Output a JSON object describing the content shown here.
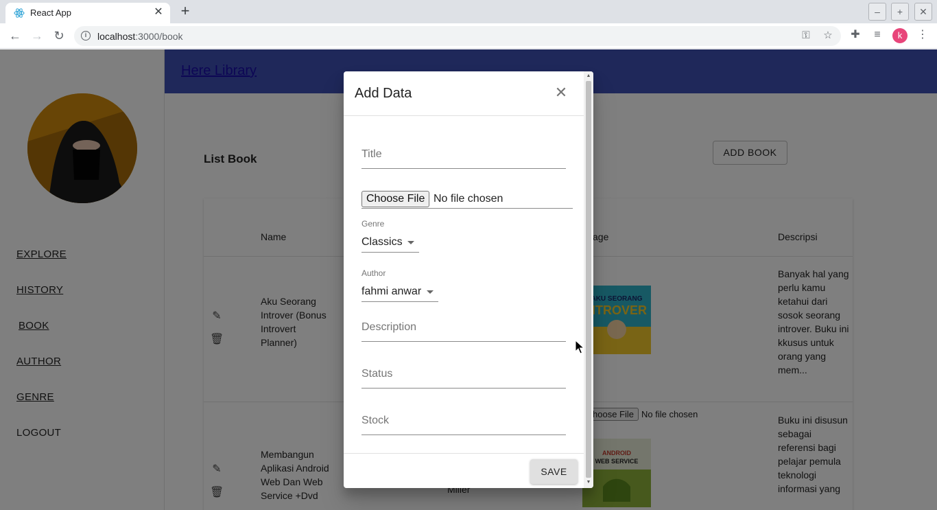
{
  "browser": {
    "tab_title": "React App",
    "url_host": "localhost",
    "url_path": ":3000/book",
    "profile_initial": "k",
    "icons": [
      "react-icon",
      "close-icon",
      "plus-icon",
      "back-icon",
      "forward-icon",
      "reload-icon",
      "info-icon",
      "key-icon",
      "star-icon",
      "puzzle-icon",
      "media-icon",
      "menu-icon"
    ]
  },
  "app": {
    "brand": "Here Library",
    "nav": [
      "EXPLORE",
      "HISTORY",
      "BOOK",
      "AUTHOR",
      "GENRE",
      "LOGOUT"
    ],
    "list_title": "List Book",
    "add_book_label": "ADD BOOK",
    "columns": {
      "name": "Name",
      "image": "age",
      "description": "Descripsi"
    },
    "rows": [
      {
        "name": "Aku Seorang Introver (Bonus Introvert Planner)",
        "image_alt": "AKU SEORANG INTROVER",
        "file_button": "hoose File",
        "file_status": "No file chosen",
        "description": "Banyak hal yang perlu kamu ketahui dari sosok seorang introver. Buku ini kkusus untuk orang yang mem..."
      },
      {
        "name": "Membangun Aplikasi Android Web Dan Web Service +Dvd",
        "author": "Miller",
        "image_alt": "ANDROID WEB DAN WEB SERVICE",
        "description": "Buku ini disusun sebagai referensi bagi pelajar pemula teknologi informasi yang"
      }
    ]
  },
  "dialog": {
    "title": "Add Data",
    "title_placeholder": "Title",
    "file_button": "Choose File",
    "file_status": "No file chosen",
    "genre_label": "Genre",
    "genre_value": "Classics",
    "author_label": "Author",
    "author_value": "fahmi anwar",
    "description_placeholder": "Description",
    "status_placeholder": "Status",
    "stock_placeholder": "Stock",
    "save_label": "SAVE"
  },
  "colors": {
    "appbar": "#3f51b5",
    "brand_link": "#1a0dab",
    "avatar_bg": "#d08a0c",
    "profile": "#e8457a"
  }
}
